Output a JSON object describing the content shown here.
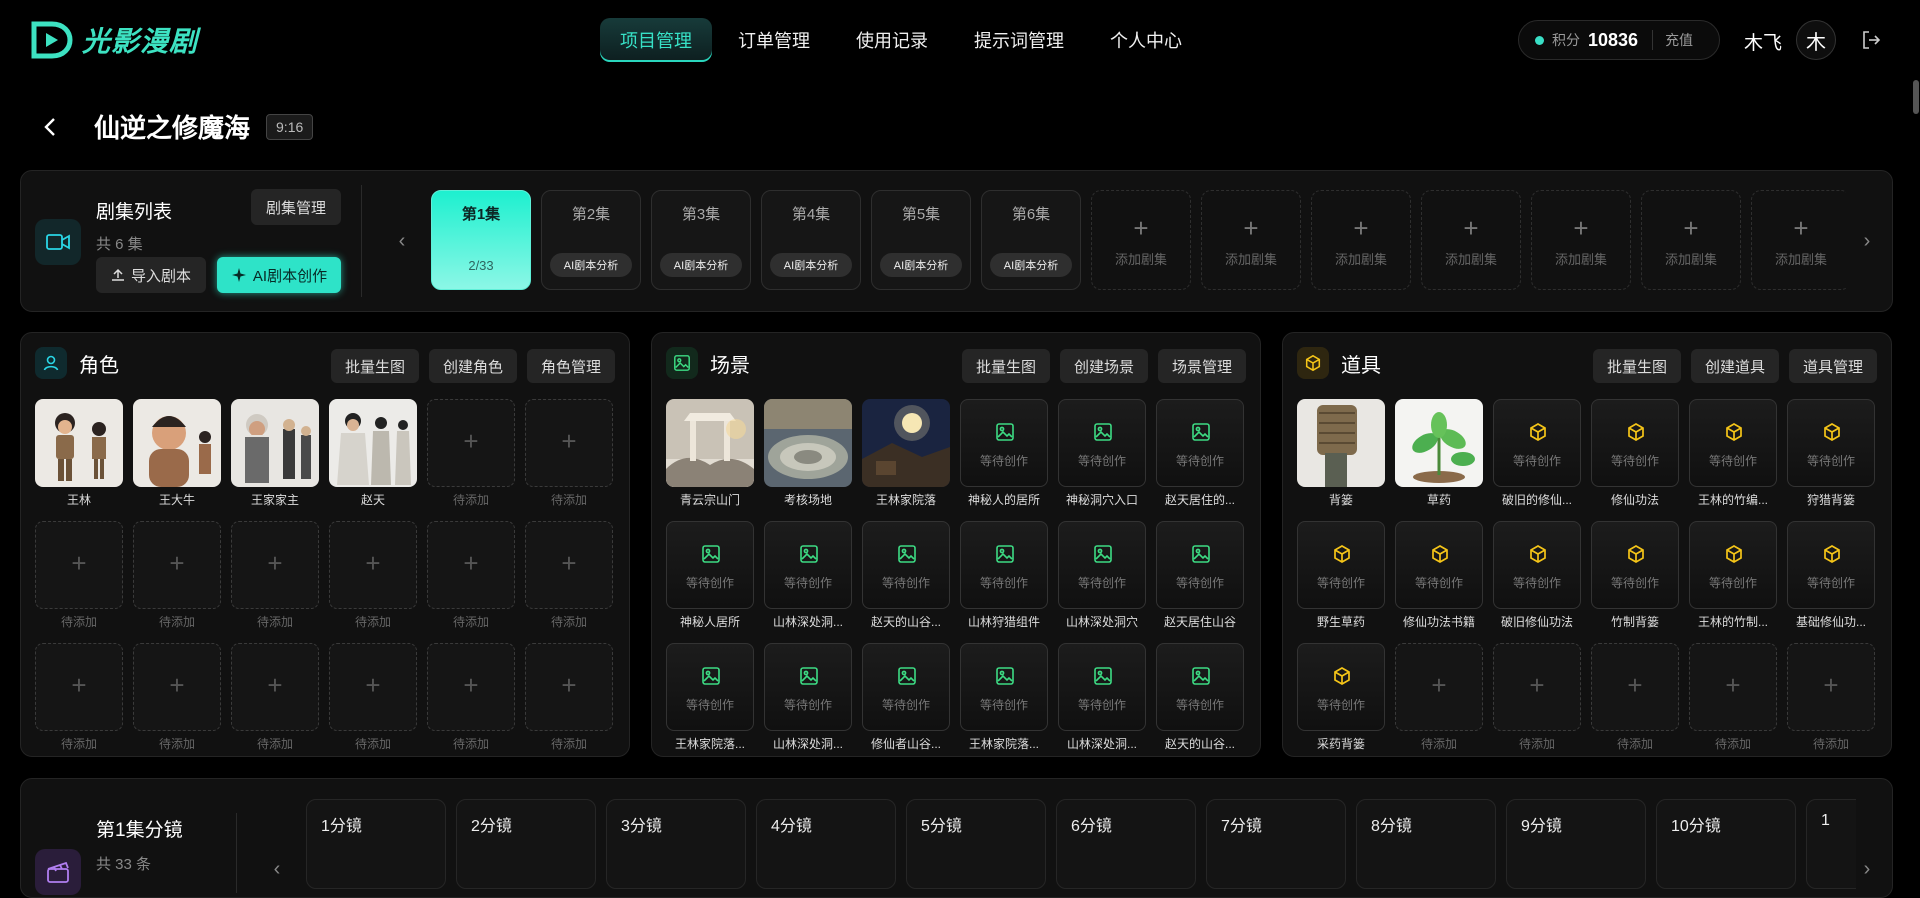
{
  "brand": {
    "name": "光影漫剧"
  },
  "nav": {
    "items": [
      "项目管理",
      "订单管理",
      "使用记录",
      "提示词管理",
      "个人中心"
    ],
    "active": 0
  },
  "account": {
    "points_label": "积分",
    "points": "10836",
    "recharge": "充值",
    "username": "木飞",
    "avatar": "木"
  },
  "project": {
    "title": "仙逆之修魔海",
    "ratio": "9:16"
  },
  "episodes": {
    "title": "剧集列表",
    "count": "共 6 集",
    "manage": "剧集管理",
    "import": "导入剧本",
    "ai_create": "AI剧本创作",
    "items": [
      {
        "name": "第1集",
        "progress": "2/33"
      },
      {
        "name": "第2集",
        "tag": "AI剧本分析"
      },
      {
        "name": "第3集",
        "tag": "AI剧本分析"
      },
      {
        "name": "第4集",
        "tag": "AI剧本分析"
      },
      {
        "name": "第5集",
        "tag": "AI剧本分析"
      },
      {
        "name": "第6集",
        "tag": "AI剧本分析"
      }
    ],
    "add_label": "添加剧集",
    "add_count": 7
  },
  "colors": {
    "accent": "#2ee3c8",
    "role_icon": "#2ad6e6",
    "scene_icon": "#3ddc84",
    "prop_icon": "#f5c518"
  },
  "panels": [
    {
      "key": "role",
      "title": "角色",
      "icon": "person-icon",
      "buttons": [
        "批量生图",
        "创建角色",
        "角色管理"
      ],
      "items": [
        {
          "name": "王林",
          "state": "img",
          "img": "boy"
        },
        {
          "name": "王大牛",
          "state": "img",
          "img": "chubby"
        },
        {
          "name": "王家家主",
          "state": "img",
          "img": "elder"
        },
        {
          "name": "赵天",
          "state": "img",
          "img": "robe"
        },
        {
          "name": "待添加",
          "state": "empty"
        },
        {
          "name": "待添加",
          "state": "empty"
        },
        {
          "name": "待添加",
          "state": "empty"
        },
        {
          "name": "待添加",
          "state": "empty"
        },
        {
          "name": "待添加",
          "state": "empty"
        },
        {
          "name": "待添加",
          "state": "empty"
        },
        {
          "name": "待添加",
          "state": "empty"
        },
        {
          "name": "待添加",
          "state": "empty"
        },
        {
          "name": "待添加",
          "state": "empty"
        },
        {
          "name": "待添加",
          "state": "empty"
        },
        {
          "name": "待添加",
          "state": "empty"
        },
        {
          "name": "待添加",
          "state": "empty"
        },
        {
          "name": "待添加",
          "state": "empty"
        },
        {
          "name": "待添加",
          "state": "empty"
        }
      ]
    },
    {
      "key": "scene",
      "title": "场景",
      "icon": "image-icon",
      "buttons": [
        "批量生图",
        "创建场景",
        "场景管理"
      ],
      "items": [
        {
          "name": "青云宗山门",
          "state": "img",
          "img": "gate"
        },
        {
          "name": "考核场地",
          "state": "img",
          "img": "arena"
        },
        {
          "name": "王林家院落",
          "state": "img",
          "img": "night"
        },
        {
          "name": "神秘人的居所",
          "state": "wait"
        },
        {
          "name": "神秘洞穴入口",
          "state": "wait"
        },
        {
          "name": "赵天居住的...",
          "state": "wait"
        },
        {
          "name": "神秘人居所",
          "state": "wait"
        },
        {
          "name": "山林深处洞...",
          "state": "wait"
        },
        {
          "name": "赵天的山谷...",
          "state": "wait"
        },
        {
          "name": "山林狩猎组件",
          "state": "wait"
        },
        {
          "name": "山林深处洞穴",
          "state": "wait"
        },
        {
          "name": "赵天居住山谷",
          "state": "wait"
        },
        {
          "name": "王林家院落...",
          "state": "wait"
        },
        {
          "name": "山林深处洞...",
          "state": "wait"
        },
        {
          "name": "修仙者山谷...",
          "state": "wait"
        },
        {
          "name": "王林家院落...",
          "state": "wait"
        },
        {
          "name": "山林深处洞...",
          "state": "wait"
        },
        {
          "name": "赵天的山谷...",
          "state": "wait"
        }
      ]
    },
    {
      "key": "prop",
      "title": "道具",
      "icon": "cube-icon",
      "buttons": [
        "批量生图",
        "创建道具",
        "道具管理"
      ],
      "items": [
        {
          "name": "背篓",
          "state": "img",
          "img": "basket"
        },
        {
          "name": "草药",
          "state": "img",
          "img": "herb"
        },
        {
          "name": "破旧的修仙...",
          "state": "wait"
        },
        {
          "name": "修仙功法",
          "state": "wait"
        },
        {
          "name": "王林的竹编...",
          "state": "wait"
        },
        {
          "name": "狩猎背篓",
          "state": "wait"
        },
        {
          "name": "野生草药",
          "state": "wait"
        },
        {
          "name": "修仙功法书籍",
          "state": "wait"
        },
        {
          "name": "破旧修仙功法",
          "state": "wait"
        },
        {
          "name": "竹制背篓",
          "state": "wait"
        },
        {
          "name": "王林的竹制...",
          "state": "wait"
        },
        {
          "name": "基础修仙功...",
          "state": "wait"
        },
        {
          "name": "采药背篓",
          "state": "wait"
        },
        {
          "name": "待添加",
          "state": "empty"
        },
        {
          "name": "待添加",
          "state": "empty"
        },
        {
          "name": "待添加",
          "state": "empty"
        },
        {
          "name": "待添加",
          "state": "empty"
        },
        {
          "name": "待添加",
          "state": "empty"
        }
      ]
    }
  ],
  "wait_label": "等待创作",
  "storyboard": {
    "title": "第1集分镜",
    "count": "共 33 条",
    "shots": [
      "1分镜",
      "2分镜",
      "3分镜",
      "4分镜",
      "5分镜",
      "6分镜",
      "7分镜",
      "8分镜",
      "9分镜",
      "10分镜",
      "1"
    ]
  }
}
